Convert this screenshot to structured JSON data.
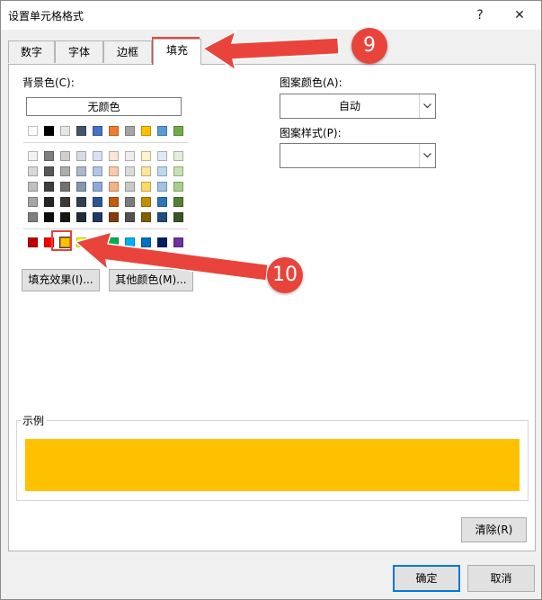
{
  "dialog": {
    "title": "设置单元格格式",
    "help_glyph": "?",
    "close_glyph": "✕"
  },
  "tabs": [
    {
      "label": "数字",
      "active": false
    },
    {
      "label": "字体",
      "active": false
    },
    {
      "label": "边框",
      "active": false
    },
    {
      "label": "填充",
      "active": true
    }
  ],
  "fill": {
    "background_label": "背景色(C):",
    "no_color_label": "无颜色",
    "theme_row": [
      "#ffffff",
      "#000000",
      "#e7e6e6",
      "#44546a",
      "#4472c4",
      "#ed7d31",
      "#a5a5a5",
      "#ffc000",
      "#5b9bd5",
      "#70ad47"
    ],
    "tint_rows": [
      [
        "#f2f2f2",
        "#7f7f7f",
        "#d0cece",
        "#d6dce4",
        "#d9e2f3",
        "#fbe5d5",
        "#ededed",
        "#fff2cc",
        "#deebf6",
        "#e2efd9"
      ],
      [
        "#d8d8d8",
        "#595959",
        "#aeabab",
        "#adb9ca",
        "#b4c6e7",
        "#f7cbac",
        "#dbdbdb",
        "#fee599",
        "#bdd7ee",
        "#c5e0b3"
      ],
      [
        "#bfbfbf",
        "#3f3f3f",
        "#757070",
        "#8496b0",
        "#8eaadb",
        "#f4b183",
        "#c9c9c9",
        "#ffd965",
        "#9dc3e6",
        "#a8d08d"
      ],
      [
        "#a5a5a5",
        "#262626",
        "#3a3838",
        "#323f4f",
        "#2f5496",
        "#c55a11",
        "#7b7b7b",
        "#bf9000",
        "#2e75b5",
        "#538135"
      ],
      [
        "#7f7f7f",
        "#0c0c0c",
        "#171616",
        "#222a35",
        "#1f3864",
        "#833c0b",
        "#525252",
        "#7f6000",
        "#1e4e79",
        "#375623"
      ]
    ],
    "standard_row": [
      "#c00000",
      "#ff0000",
      "#ffc000",
      "#ffff00",
      "#92d050",
      "#00b050",
      "#00b0f0",
      "#0070c0",
      "#002060",
      "#7030a0"
    ],
    "selected_standard_index": 2,
    "fill_effects_label": "填充效果(I)...",
    "more_colors_label": "其他颜色(M)...",
    "pattern_color_label": "图案颜色(A):",
    "pattern_color_value": "自动",
    "pattern_style_label": "图案样式(P):",
    "pattern_style_value": "",
    "sample_label": "示例",
    "sample_color": "#ffc000",
    "clear_label": "清除(R)"
  },
  "footer": {
    "ok_label": "确定",
    "cancel_label": "取消"
  },
  "annotations": {
    "callout_a": "9",
    "callout_b": "10",
    "accent": "#e8443c"
  }
}
